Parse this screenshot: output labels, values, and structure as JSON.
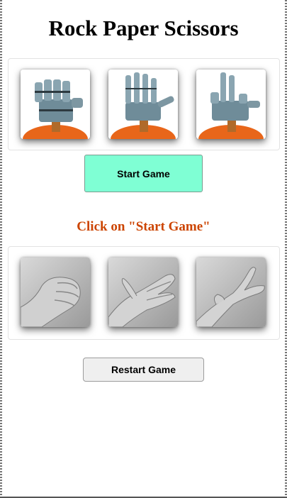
{
  "page": {
    "title": "Rock Paper Scissors"
  },
  "robot_choices": [
    {
      "name": "rock",
      "icon": "robot-fist-icon"
    },
    {
      "name": "paper",
      "icon": "robot-open-hand-icon"
    },
    {
      "name": "scissors",
      "icon": "robot-scissors-hand-icon"
    }
  ],
  "buttons": {
    "start": "Start Game",
    "restart": "Restart Game"
  },
  "status": {
    "message": "Click on \"Start Game\""
  },
  "player_choices": [
    {
      "name": "rock",
      "icon": "human-fist-icon"
    },
    {
      "name": "paper",
      "icon": "human-flat-hand-icon"
    },
    {
      "name": "scissors",
      "icon": "human-scissors-hand-icon"
    }
  ],
  "colors": {
    "start_button": "#7fffd4",
    "status_text": "#cc4400",
    "restart_button": "#efefef"
  }
}
